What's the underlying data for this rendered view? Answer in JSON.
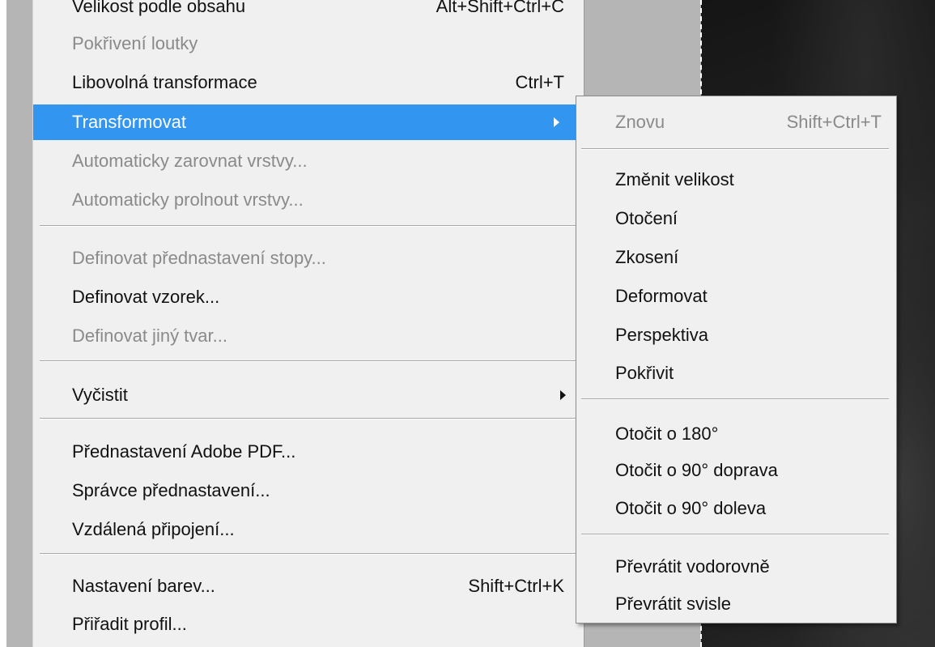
{
  "menu": {
    "cut_top_label": "Velikost podle obsahu",
    "cut_top_shortcut": "Alt+Shift+Ctrl+C",
    "items": [
      {
        "label": "Pokřivení loutky",
        "shortcut": ""
      },
      {
        "label": "Libovolná transformace",
        "shortcut": "Ctrl+T"
      },
      {
        "label": "Transformovat",
        "shortcut": ""
      },
      {
        "label": "Automaticky zarovnat vrstvy...",
        "shortcut": ""
      },
      {
        "label": "Automaticky prolnout vrstvy...",
        "shortcut": ""
      },
      {
        "label": "Definovat přednastavení stopy...",
        "shortcut": ""
      },
      {
        "label": "Definovat vzorek...",
        "shortcut": ""
      },
      {
        "label": "Definovat jiný tvar...",
        "shortcut": ""
      },
      {
        "label": "Vyčistit",
        "shortcut": ""
      },
      {
        "label": "Přednastavení Adobe PDF...",
        "shortcut": ""
      },
      {
        "label": "Správce přednastavení...",
        "shortcut": ""
      },
      {
        "label": "Vzdálená připojení...",
        "shortcut": ""
      },
      {
        "label": "Nastavení barev...",
        "shortcut": "Shift+Ctrl+K"
      },
      {
        "label": "Přiřadit profil...",
        "shortcut": ""
      }
    ]
  },
  "submenu": {
    "items": [
      {
        "label": "Znovu",
        "shortcut": "Shift+Ctrl+T"
      },
      {
        "label": "Změnit velikost",
        "shortcut": ""
      },
      {
        "label": "Otočení",
        "shortcut": ""
      },
      {
        "label": "Zkosení",
        "shortcut": ""
      },
      {
        "label": "Deformovat",
        "shortcut": ""
      },
      {
        "label": "Perspektiva",
        "shortcut": ""
      },
      {
        "label": "Pokřivit",
        "shortcut": ""
      },
      {
        "label": "Otočit o 180°",
        "shortcut": ""
      },
      {
        "label": "Otočit o 90° doprava",
        "shortcut": ""
      },
      {
        "label": "Otočit o 90° doleva",
        "shortcut": ""
      },
      {
        "label": "Převrátit vodorovně",
        "shortcut": ""
      },
      {
        "label": "Převrátit svisle",
        "shortcut": ""
      }
    ]
  },
  "colors": {
    "highlight": "#3296f0",
    "menu_bg": "#f0f0f0",
    "disabled_text": "#8a8a8a"
  }
}
